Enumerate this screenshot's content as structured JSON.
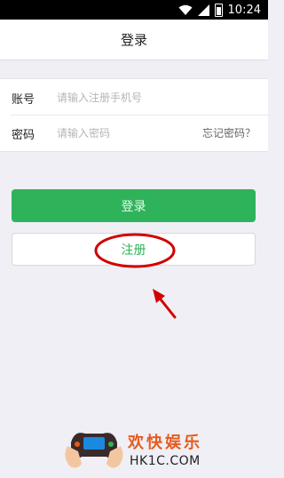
{
  "status_bar": {
    "time": "10:24",
    "icons": [
      "wifi-icon",
      "signal-icon",
      "battery-icon"
    ]
  },
  "header": {
    "title": "登录"
  },
  "form": {
    "account": {
      "label": "账号",
      "placeholder": "请输入注册手机号",
      "value": ""
    },
    "password": {
      "label": "密码",
      "placeholder": "请输入密码",
      "value": ""
    },
    "forgot_link": "忘记密码？"
  },
  "buttons": {
    "login": "登录",
    "register": "注册"
  },
  "colors": {
    "accent": "#2fb35a",
    "annotation": "#d10000",
    "watermark": "#e85a1b"
  },
  "watermark": {
    "cn": "欢快娱乐",
    "en": "HK1C.COM"
  }
}
